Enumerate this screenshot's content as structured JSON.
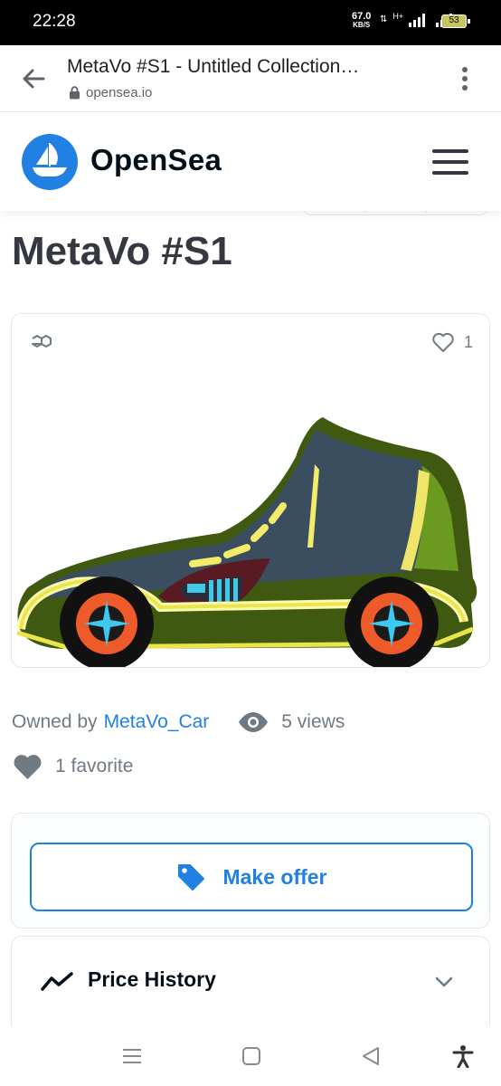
{
  "status_bar": {
    "time": "22:28",
    "net_speed": "67.0",
    "net_unit": "KB/S",
    "net_type": "H+",
    "battery": "53"
  },
  "browser": {
    "page_title": "MetaVo #S1 - Untitled Collection…",
    "url": "opensea.io",
    "icons": {
      "back": "back-arrow-icon",
      "lock": "lock-icon",
      "menu": "more-vert-icon"
    }
  },
  "site_header": {
    "brand": "OpenSea",
    "brand_color": "#2081e2",
    "icons": {
      "logo": "opensea-sailboat-icon",
      "menu": "hamburger-menu-icon"
    }
  },
  "item": {
    "title": "MetaVo #S1",
    "favorite_count": "1",
    "owned_by_label": "Owned by",
    "owner": "MetaVo_Car",
    "views": "5 views",
    "favorites": "1 favorite",
    "icons": {
      "chain": "polygon-chain-icon",
      "favorite": "heart-outline-icon",
      "views": "eye-icon",
      "favorites": "heart-icon"
    }
  },
  "actions": {
    "make_offer": "Make offer",
    "make_offer_icon": "tag-icon"
  },
  "price_history": {
    "label": "Price History",
    "icon": "trend-line-icon",
    "toggle_icon": "chevron-down-icon"
  },
  "system_nav": {
    "icons": [
      "recents-menu-icon",
      "home-square-icon",
      "back-triangle-icon",
      "accessibility-icon"
    ]
  },
  "colors": {
    "accent": "#2081e2",
    "text_dark": "#04111d",
    "text_muted": "#707a83",
    "title_gray": "#353840"
  }
}
